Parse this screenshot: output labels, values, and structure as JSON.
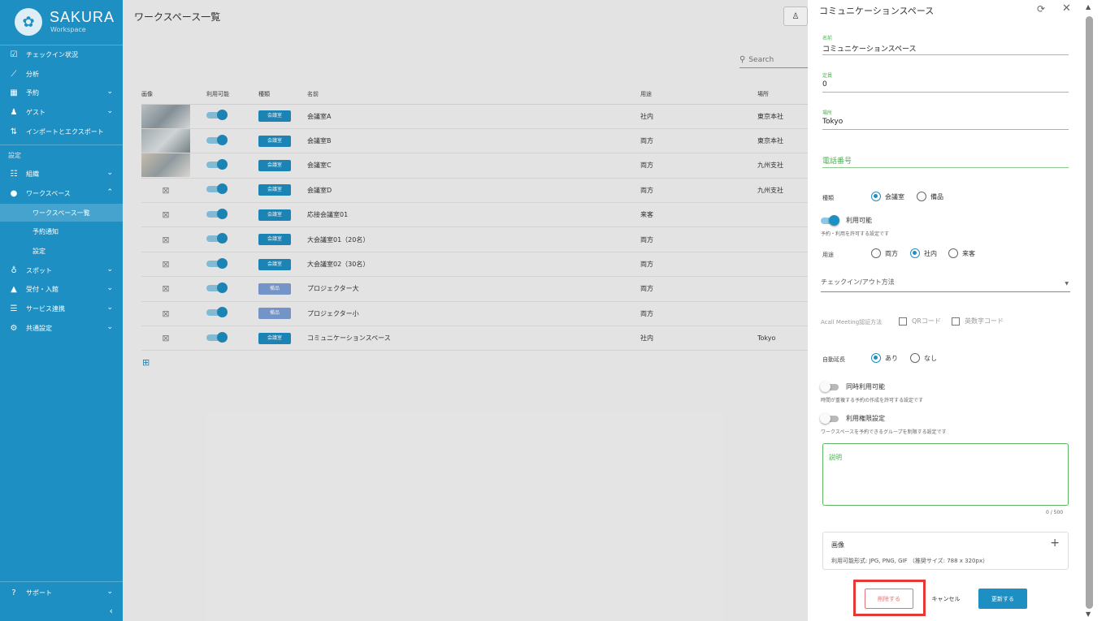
{
  "sidebar": {
    "brand": "SAKURA",
    "brand_sub": "Workspace",
    "items": [
      {
        "label": "チェックイン状況",
        "icon": "checkbox-icon"
      },
      {
        "label": "分析",
        "icon": "chart-icon"
      },
      {
        "label": "予約",
        "icon": "calendar-icon"
      },
      {
        "label": "ゲスト",
        "icon": "guest-icon"
      },
      {
        "label": "インポートとエクスポート",
        "icon": "import-export-icon"
      }
    ],
    "settings_section": "設定",
    "settings_items": [
      {
        "label": "組織",
        "icon": "org-icon"
      },
      {
        "label": "ワークスペース",
        "icon": "location-icon"
      }
    ],
    "workspace_sub": [
      "ワークスペース一覧",
      "予約通知",
      "設定"
    ],
    "more_items": [
      {
        "label": "スポット",
        "icon": "spot-icon"
      },
      {
        "label": "受付・入館",
        "icon": "reception-icon"
      },
      {
        "label": "サービス連携",
        "icon": "service-icon"
      },
      {
        "label": "共通設定",
        "icon": "settings-icon"
      }
    ],
    "support": "サポート"
  },
  "main": {
    "title": "ワークスペース一覧",
    "search_placeholder": "Search",
    "columns": [
      "画像",
      "利用可能",
      "種類",
      "名前",
      "用途",
      "場所"
    ],
    "rows": [
      {
        "image": "photo1",
        "type": "会議室",
        "name": "会議室A",
        "use": "社内",
        "place": "東京本社"
      },
      {
        "image": "photo2",
        "type": "会議室",
        "name": "会議室B",
        "use": "両方",
        "place": "東京本社"
      },
      {
        "image": "photo3",
        "type": "会議室",
        "name": "会議室C",
        "use": "両方",
        "place": "九州支社"
      },
      {
        "image": "none",
        "type": "会議室",
        "name": "会議室D",
        "use": "両方",
        "place": "九州支社"
      },
      {
        "image": "none",
        "type": "会議室",
        "name": "応接会議室01",
        "use": "来客",
        "place": ""
      },
      {
        "image": "none",
        "type": "会議室",
        "name": "大会議室01（20名）",
        "use": "両方",
        "place": ""
      },
      {
        "image": "none",
        "type": "会議室",
        "name": "大会議室02（30名）",
        "use": "両方",
        "place": ""
      },
      {
        "image": "none",
        "type": "備品",
        "name": "プロジェクター大",
        "use": "両方",
        "place": ""
      },
      {
        "image": "none",
        "type": "備品",
        "name": "プロジェクター小",
        "use": "両方",
        "place": ""
      },
      {
        "image": "none",
        "type": "会議室",
        "name": "コミュニケーションスペース",
        "use": "社内",
        "place": "Tokyo"
      }
    ]
  },
  "drawer": {
    "title": "コミュニケーションスペース",
    "name_label": "名前",
    "name_value": "コミュニケーションスペース",
    "capacity_label": "定員",
    "capacity_value": "0",
    "place_label": "場所",
    "place_value": "Tokyo",
    "phone_label": "電話番号",
    "type_label": "種類",
    "type_options": [
      "会議室",
      "備品"
    ],
    "available_label": "利用可能",
    "available_hint": "予約・利用を許可する設定です",
    "use_label": "用途",
    "use_options": [
      "両方",
      "社内",
      "来客"
    ],
    "checkin_select": "チェックイン/アウト方法",
    "acall_label": "Acall Meeting認証方法",
    "acall_options": [
      "QRコード",
      "英数字コード"
    ],
    "auto_extend_label": "自動延長",
    "auto_extend_options": [
      "あり",
      "なし"
    ],
    "concurrent_label": "同時利用可能",
    "concurrent_hint": "時間が重複する予約の作成を許可する設定です",
    "permission_label": "利用権限設定",
    "permission_hint": "ワークスペースを予約できるグループを制限する設定です",
    "description_label": "説明",
    "description_counter": "0 / 500",
    "image_title": "画像",
    "image_desc": "利用可能形式: JPG, PNG, GIF （推奨サイズ: 788 x 320px）",
    "delete_button": "削除する",
    "cancel_button": "キャンセル",
    "update_button": "更新する"
  }
}
